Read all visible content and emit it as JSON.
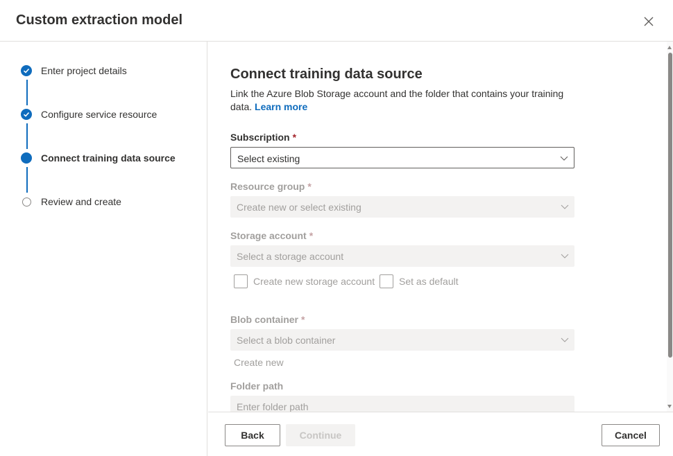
{
  "dialog": {
    "title": "Custom extraction model"
  },
  "steps": [
    {
      "label": "Enter project details",
      "state": "done"
    },
    {
      "label": "Configure service resource",
      "state": "done"
    },
    {
      "label": "Connect training data source",
      "state": "current"
    },
    {
      "label": "Review and create",
      "state": "pending"
    }
  ],
  "main": {
    "title": "Connect training data source",
    "description": "Link the Azure Blob Storage account and the folder that contains your training data.",
    "learn_more": "Learn more",
    "required_mark": "*",
    "subscription": {
      "label": "Subscription",
      "value": "Select existing"
    },
    "resource_group": {
      "label": "Resource group",
      "value": "Create new or select existing"
    },
    "storage_account": {
      "label": "Storage account",
      "value": "Select a storage account"
    },
    "create_new_storage": "Create new storage account",
    "set_as_default": "Set as default",
    "blob_container": {
      "label": "Blob container",
      "value": "Select a blob container"
    },
    "create_new": "Create new",
    "folder_path": {
      "label": "Folder path",
      "placeholder": "Enter folder path"
    }
  },
  "footer": {
    "back": "Back",
    "continue": "Continue",
    "cancel": "Cancel"
  },
  "colors": {
    "accent": "#0f6cbd",
    "required": "#a4262c"
  },
  "icons": {
    "close": "close-icon",
    "step_done": "checkmark-icon",
    "dropdown": "chevron-down-icon"
  }
}
